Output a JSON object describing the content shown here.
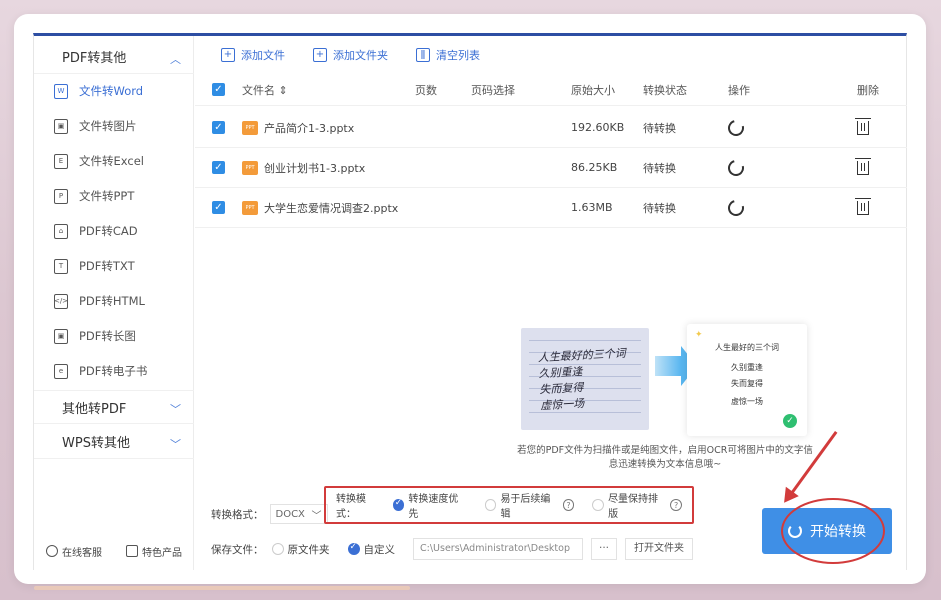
{
  "sidebar": {
    "group1": "PDF转其他",
    "items": [
      {
        "label": "文件转Word",
        "icon": "W"
      },
      {
        "label": "文件转图片",
        "icon": "▣"
      },
      {
        "label": "文件转Excel",
        "icon": "E"
      },
      {
        "label": "文件转PPT",
        "icon": "P"
      },
      {
        "label": "PDF转CAD",
        "icon": "⌂"
      },
      {
        "label": "PDF转TXT",
        "icon": "T"
      },
      {
        "label": "PDF转HTML",
        "icon": "</>"
      },
      {
        "label": "PDF转长图",
        "icon": "▣"
      },
      {
        "label": "PDF转电子书",
        "icon": "e"
      }
    ],
    "group2": "其他转PDF",
    "group3": "WPS转其他",
    "footer": {
      "support": "在线客服",
      "products": "特色产品"
    }
  },
  "toolbar": {
    "add_file": "添加文件",
    "add_folder": "添加文件夹",
    "clear_list": "清空列表"
  },
  "table": {
    "headers": {
      "name": "文件名 ⇕",
      "pages": "页数",
      "page_select": "页码选择",
      "size": "原始大小",
      "status": "转换状态",
      "action": "操作",
      "delete": "删除"
    },
    "rows": [
      {
        "name": "产品简介1-3.pptx",
        "size": "192.60KB",
        "status": "待转换"
      },
      {
        "name": "创业计划书1-3.pptx",
        "size": "86.25KB",
        "status": "待转换"
      },
      {
        "name": "大学生恋爱情况调查2.pptx",
        "size": "1.63MB",
        "status": "待转换"
      }
    ]
  },
  "ocr": {
    "handwriting": [
      "人生最好的三个词",
      "久别重逢",
      "失而复得",
      "虚惊一场"
    ],
    "doc_lines": [
      "人生最好的三个词",
      "久别重逢",
      "失而复得",
      "虚惊一场"
    ],
    "caption": "若您的PDF文件为扫描件或是纯图文件，启用OCR可将图片中的文字信息迅速转换为文本信息哦~"
  },
  "settings": {
    "format_label": "转换格式：",
    "format_value": "DOCX",
    "mode_label": "转换模式：",
    "mode_options": [
      "转换速度优先",
      "易于后续编辑",
      "尽量保持排版"
    ],
    "save_label": "保存文件：",
    "save_original": "原文件夹",
    "save_custom": "自定义",
    "save_path": "C:\\Users\\Administrator\\Desktop",
    "dots": "···",
    "open_folder": "打开文件夹"
  },
  "start_button": "开始转换"
}
